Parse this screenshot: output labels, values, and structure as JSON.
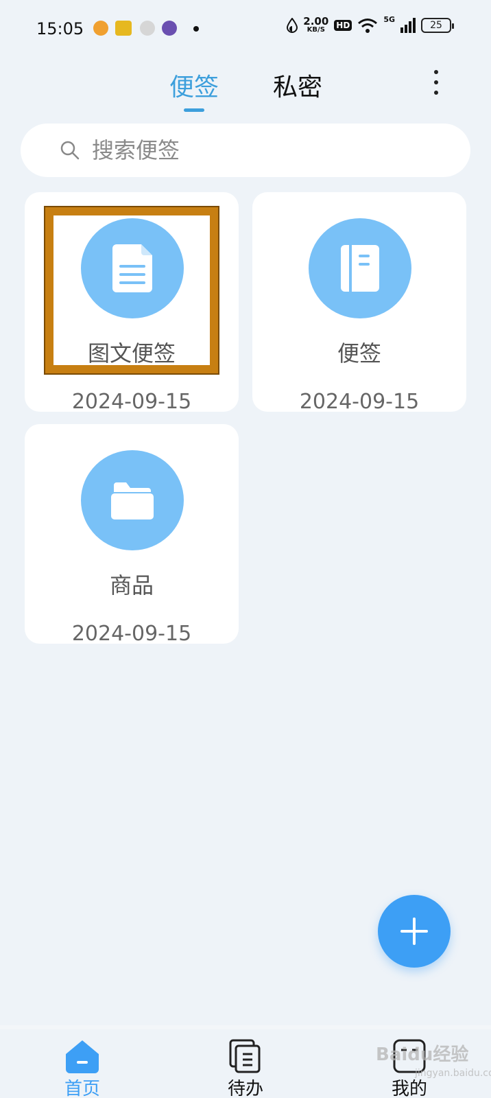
{
  "status_bar": {
    "time": "15:05",
    "net_speed_value": "2.00",
    "net_speed_unit": "KB/S",
    "hd": "HD",
    "network": "5G",
    "battery": "25"
  },
  "header": {
    "tabs": [
      {
        "label": "便签",
        "active": true
      },
      {
        "label": "私密",
        "active": false
      }
    ]
  },
  "search": {
    "placeholder": "搜索便签"
  },
  "notes": [
    {
      "title": "图文便签",
      "date": "2024-09-15",
      "icon": "document-icon"
    },
    {
      "title": "便签",
      "date": "2024-09-15",
      "icon": "notebook-icon"
    },
    {
      "title": "商品",
      "date": "2024-09-15",
      "icon": "folder-icon"
    }
  ],
  "bottom_nav": {
    "items": [
      {
        "label": "首页",
        "icon": "home-icon",
        "active": true
      },
      {
        "label": "待办",
        "icon": "todo-icon",
        "active": false
      },
      {
        "label": "我的",
        "icon": "profile-icon",
        "active": false
      }
    ]
  },
  "watermark": {
    "text": "Baidu经验",
    "sub": "jingyan.baidu.com"
  },
  "colors": {
    "accent": "#3d9fdc",
    "fab": "#3d9ff5",
    "icon_circle": "#79c1f7",
    "highlight_border": "#c77f12"
  }
}
